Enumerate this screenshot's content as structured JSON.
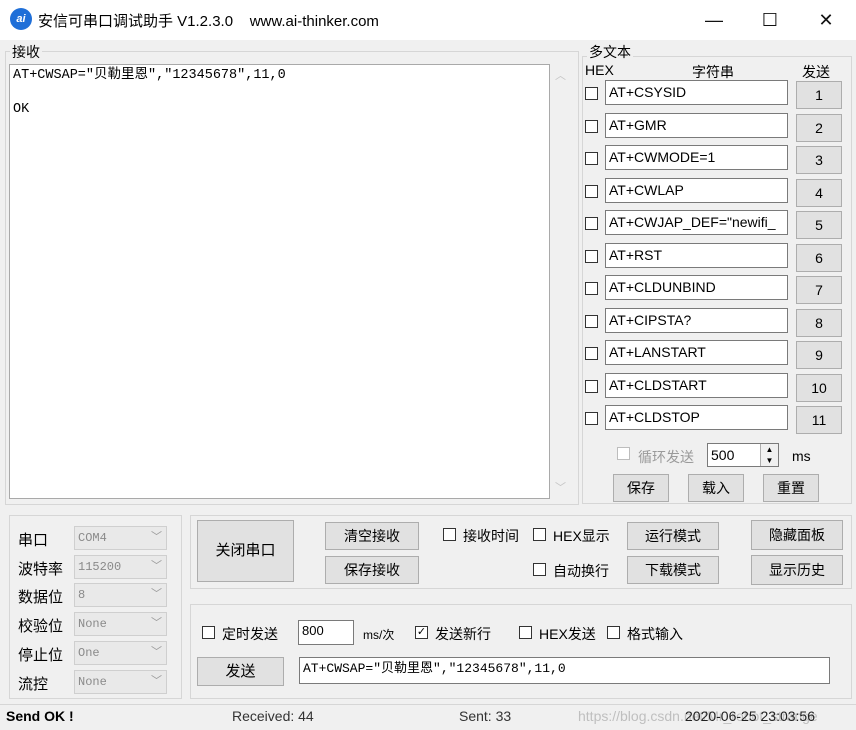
{
  "window": {
    "title": "安信可串口调试助手 V1.2.3.0    www.ai-thinker.com",
    "icon_text": "ai",
    "minimize": "—",
    "maximize": "☐",
    "close": "✕"
  },
  "receive": {
    "label": "接收",
    "lines": [
      "AT+CWSAP=\"贝勒里恩\",\"12345678\",11,0",
      "",
      "OK"
    ],
    "scroll_up": "︿",
    "scroll_down": "﹀"
  },
  "multitext": {
    "label": "多文本",
    "hex_header": "HEX",
    "string_header": "字符串",
    "send_header": "发送",
    "rows": [
      {
        "text": "AT+CSYSID",
        "button": "1"
      },
      {
        "text": "AT+GMR",
        "button": "2"
      },
      {
        "text": "AT+CWMODE=1",
        "button": "3"
      },
      {
        "text": "AT+CWLAP",
        "button": "4"
      },
      {
        "text": "AT+CWJAP_DEF=\"newifi_",
        "button": "5"
      },
      {
        "text": "AT+RST",
        "button": "6"
      },
      {
        "text": "AT+CLDUNBIND",
        "button": "7"
      },
      {
        "text": "AT+CIPSTA?",
        "button": "8"
      },
      {
        "text": "AT+LANSTART",
        "button": "9"
      },
      {
        "text": "AT+CLDSTART",
        "button": "10"
      },
      {
        "text": "AT+CLDSTOP",
        "button": "11"
      }
    ],
    "loop_send_label": "循环发送",
    "loop_interval": "500",
    "loop_unit": "ms",
    "save_label": "保存",
    "load_label": "载入",
    "reset_label": "重置"
  },
  "port": {
    "rows": [
      {
        "label": "串口",
        "value": "COM4"
      },
      {
        "label": "波特率",
        "value": "115200"
      },
      {
        "label": "数据位",
        "value": "8"
      },
      {
        "label": "校验位",
        "value": "None"
      },
      {
        "label": "停止位",
        "value": "One"
      },
      {
        "label": "流控",
        "value": "None"
      }
    ]
  },
  "controls": {
    "close_port": "关闭串口",
    "clear_receive": "清空接收",
    "save_receive": "保存接收",
    "receive_time": "接收时间",
    "hex_display": "HEX显示",
    "auto_wrap": "自动换行",
    "run_mode": "运行模式",
    "download_mode": "下载模式",
    "hide_panel": "隐藏面板",
    "show_history": "显示历史"
  },
  "send": {
    "timed_send": "定时发送",
    "interval": "800",
    "interval_unit": "ms/次",
    "send_newline": "发送新行",
    "hex_send": "HEX发送",
    "format_input": "格式输入",
    "send_button": "发送",
    "input_value": "AT+CWSAP=\"贝勒里恩\",\"12345678\",11,0",
    "checkmark": "✓"
  },
  "status": {
    "message": "Send OK !",
    "received": "Received: 44",
    "sent": "Sent: 33",
    "watermark": "https://blog.csdn.net/Mr_robot_strange",
    "datetime": "2020-06-25 23:03:56"
  }
}
